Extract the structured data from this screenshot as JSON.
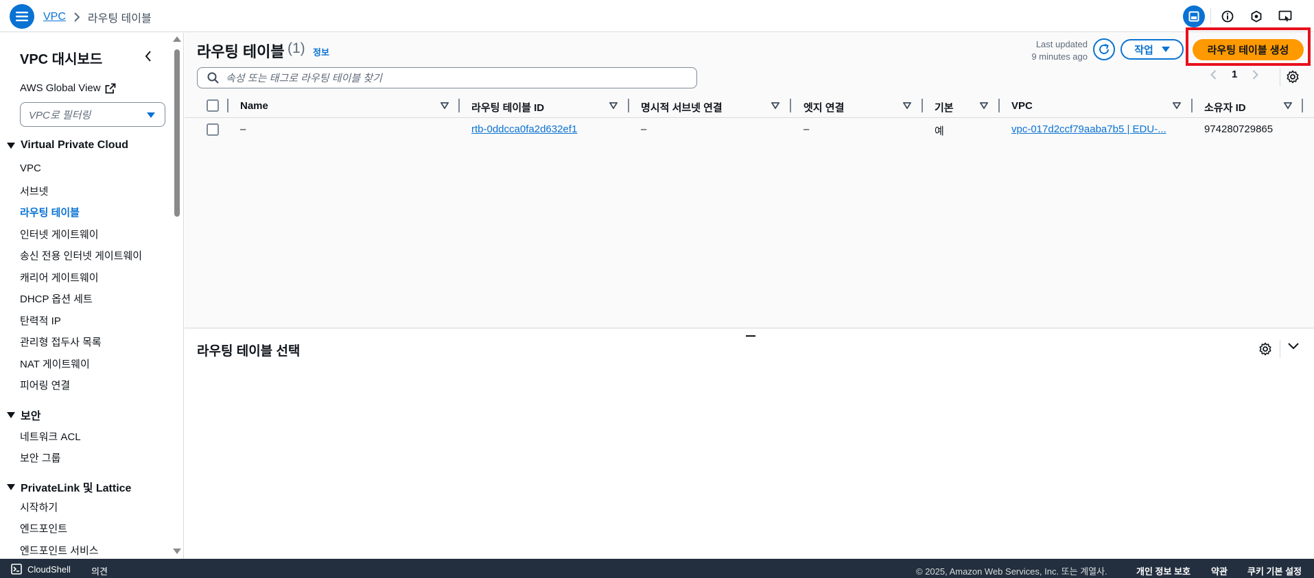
{
  "header": {
    "breadcrumb_root": "VPC",
    "breadcrumb_current": "라우팅 테이블"
  },
  "sidebar": {
    "title": "VPC 대시보드",
    "global_view": "AWS Global View",
    "filter_placeholder": "VPC로 필터링",
    "sections": [
      {
        "label": "Virtual Private Cloud"
      },
      {
        "label": "보안"
      },
      {
        "label": "PrivateLink 및 Lattice"
      }
    ],
    "vpc_items": [
      "VPC",
      "서브넷",
      "라우팅 테이블",
      "인터넷 게이트웨이",
      "송신 전용 인터넷 게이트웨이",
      "캐리어 게이트웨이",
      "DHCP 옵션 세트",
      "탄력적 IP",
      "관리형 접두사 목록",
      "NAT 게이트웨이",
      "피어링 연결"
    ],
    "security_items": [
      "네트워크 ACL",
      "보안 그룹"
    ],
    "privatelink_items": [
      "시작하기",
      "엔드포인트",
      "엔드포인트 서비스"
    ],
    "active_item": "라우팅 테이블"
  },
  "main": {
    "title": "라우팅 테이블",
    "count": "(1)",
    "info": "정보",
    "last_updated_line1": "Last updated",
    "last_updated_line2": "9 minutes ago",
    "actions_label": "작업",
    "create_label": "라우팅 테이블 생성",
    "search_placeholder": "속성 또는 태그로 라우팅 테이블 찾기",
    "page_number": "1"
  },
  "table": {
    "columns": [
      "Name",
      "라우팅 테이블 ID",
      "명시적 서브넷 연결",
      "엣지 연결",
      "기본",
      "VPC",
      "소유자 ID"
    ],
    "rows": [
      {
        "name": "–",
        "route_table_id": "rtb-0ddcca0fa2d632ef1",
        "explicit_subnet": "–",
        "edge": "–",
        "main": "예",
        "vpc": "vpc-017d2ccf79aaba7b5 | EDU-...",
        "owner_id": "974280729865"
      }
    ]
  },
  "bottom_panel": {
    "title": "라우팅 테이블 선택"
  },
  "footer": {
    "cloudshell": "CloudShell",
    "feedback": "의견",
    "copyright": "© 2025, Amazon Web Services, Inc. 또는 계열사.",
    "privacy": "개인 정보 보호",
    "terms": "약관",
    "cookie": "쿠키 기본 설정"
  },
  "colors": {
    "accent": "#0972d3",
    "primary_button": "#ff9900",
    "highlight": "#e8101c",
    "footer_bg": "#232f3e"
  }
}
